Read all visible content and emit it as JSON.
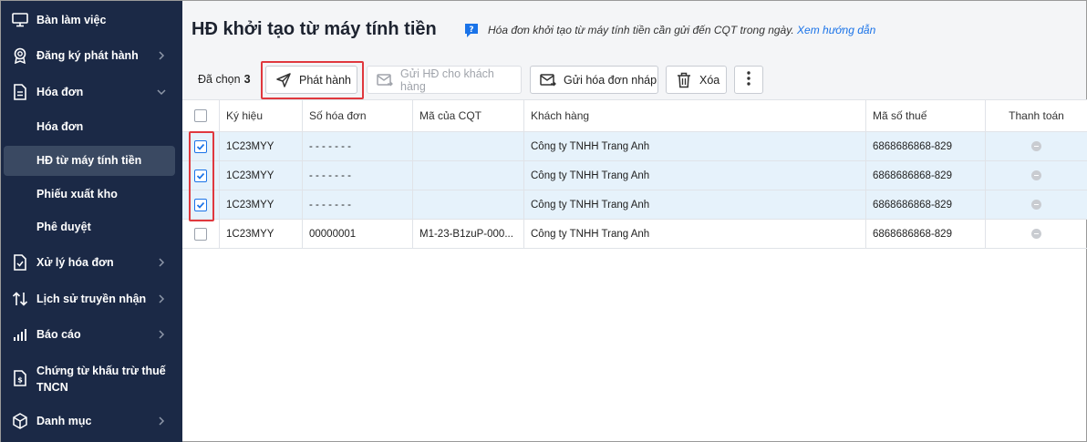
{
  "sidebar": {
    "items": [
      {
        "label": "Bàn làm việc",
        "icon": "monitor-icon"
      },
      {
        "label": "Đăng ký phát hành",
        "icon": "badge-icon"
      },
      {
        "label": "Hóa đơn",
        "icon": "document-icon"
      },
      {
        "label": "Xử lý hóa đơn",
        "icon": "document-check-icon"
      },
      {
        "label": "Lịch sử truyền nhận",
        "icon": "transfer-arrows-icon"
      },
      {
        "label": "Báo cáo",
        "icon": "bar-chart-icon"
      },
      {
        "label": "Chứng từ khấu trừ thuế",
        "label2": "TNCN",
        "icon": "tax-document-icon"
      },
      {
        "label": "Danh mục",
        "icon": "cube-icon"
      }
    ],
    "sub_items": [
      {
        "label": "Hóa đơn"
      },
      {
        "label": "HĐ từ máy tính tiền"
      },
      {
        "label": "Phiếu xuất kho"
      },
      {
        "label": "Phê duyệt"
      }
    ]
  },
  "header": {
    "title": "HĐ khởi tạo từ máy tính tiền",
    "hint_text": "Hóa đơn khởi tạo từ máy tính tiền cần gửi đến CQT trong ngày.",
    "hint_link": "Xem hướng dẫn"
  },
  "toolbar": {
    "selected_label": "Đã chọn",
    "selected_count": "3",
    "publish": "Phát hành",
    "send_customer": "Gửi HĐ cho khách hàng",
    "send_draft": "Gửi hóa đơn nháp",
    "delete": "Xóa"
  },
  "table": {
    "columns": [
      "Ký hiệu",
      "Số hóa đơn",
      "Mã của CQT",
      "Khách hàng",
      "Mã số thuế",
      "Thanh toán"
    ],
    "rows": [
      {
        "checked": true,
        "ky_hieu": "1C23MYY",
        "so_hd": "- - - - - - -",
        "ma_cqt": "",
        "khach_hang": "Công ty TNHH Trang Anh",
        "mst": "6868686868-829"
      },
      {
        "checked": true,
        "ky_hieu": "1C23MYY",
        "so_hd": "- - - - - - -",
        "ma_cqt": "",
        "khach_hang": "Công ty TNHH Trang Anh",
        "mst": "6868686868-829"
      },
      {
        "checked": true,
        "ky_hieu": "1C23MYY",
        "so_hd": "- - - - - - -",
        "ma_cqt": "",
        "khach_hang": "Công ty TNHH Trang Anh",
        "mst": "6868686868-829"
      },
      {
        "checked": false,
        "ky_hieu": "1C23MYY",
        "so_hd": "00000001",
        "ma_cqt": "M1-23-B1zuP-000...",
        "khach_hang": "Công ty TNHH Trang Anh",
        "mst": "6868686868-829"
      }
    ]
  },
  "colors": {
    "sidebar_bg": "#1b2946",
    "accent": "#1a73e8",
    "highlight_red": "#e0383e",
    "selected_row": "#e6f2fb"
  }
}
